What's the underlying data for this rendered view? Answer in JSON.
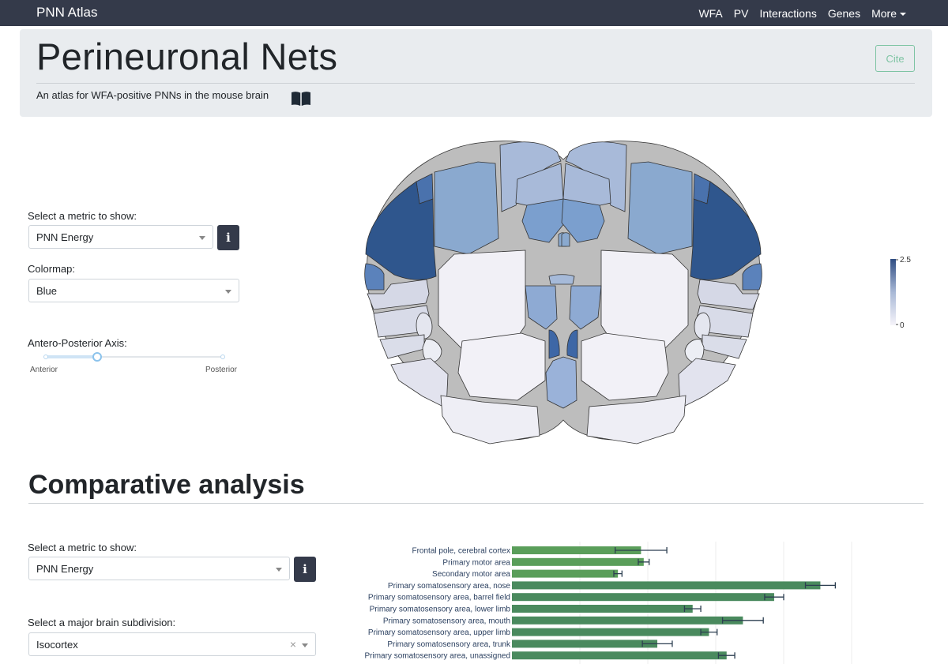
{
  "navbar": {
    "brand": "PNN Atlas",
    "links": [
      "WFA",
      "PV",
      "Interactions",
      "Genes",
      "More"
    ]
  },
  "header": {
    "title": "Perineuronal Nets",
    "subtitle": "An atlas for WFA-positive PNNs in the mouse brain",
    "cite_label": "Cite"
  },
  "brain_panel": {
    "metric_label": "Select a metric to show:",
    "metric_value": "PNN Energy",
    "colormap_label": "Colormap:",
    "colormap_value": "Blue",
    "axis_label": "Antero-Posterior Axis:",
    "axis_start": "Anterior",
    "axis_end": "Posterior",
    "axis_position": 0.29,
    "colorbar_max": "2.5",
    "colorbar_min": "0"
  },
  "comparative": {
    "title": "Comparative analysis",
    "metric_label": "Select a metric to show:",
    "metric_value": "PNN Energy",
    "subdivision_label": "Select a major brain subdivision:",
    "subdivision_value": "Isocortex"
  },
  "chart_data": {
    "type": "bar",
    "orientation": "horizontal",
    "categories": [
      "Frontal pole, cerebral cortex",
      "Primary motor area",
      "Secondary motor area",
      "Primary somatosensory area, nose",
      "Primary somatosensory area, barrel field",
      "Primary somatosensory area, lower limb",
      "Primary somatosensory area, mouth",
      "Primary somatosensory area, upper limb",
      "Primary somatosensory area, trunk",
      "Primary somatosensory area, unassigned"
    ],
    "values": [
      0.95,
      0.97,
      0.78,
      2.27,
      1.93,
      1.33,
      1.7,
      1.45,
      1.07,
      1.58
    ],
    "error": [
      0.19,
      0.04,
      0.03,
      0.11,
      0.07,
      0.06,
      0.15,
      0.06,
      0.11,
      0.06
    ],
    "xlim": [
      0,
      2.5
    ],
    "colors": {
      "bar": "#4a8a5e",
      "bar_light": "#5a9e5a",
      "error": "#2c3e50"
    }
  },
  "colors": {
    "navbar": "#343a4a",
    "accent": "#7ec4a3"
  }
}
